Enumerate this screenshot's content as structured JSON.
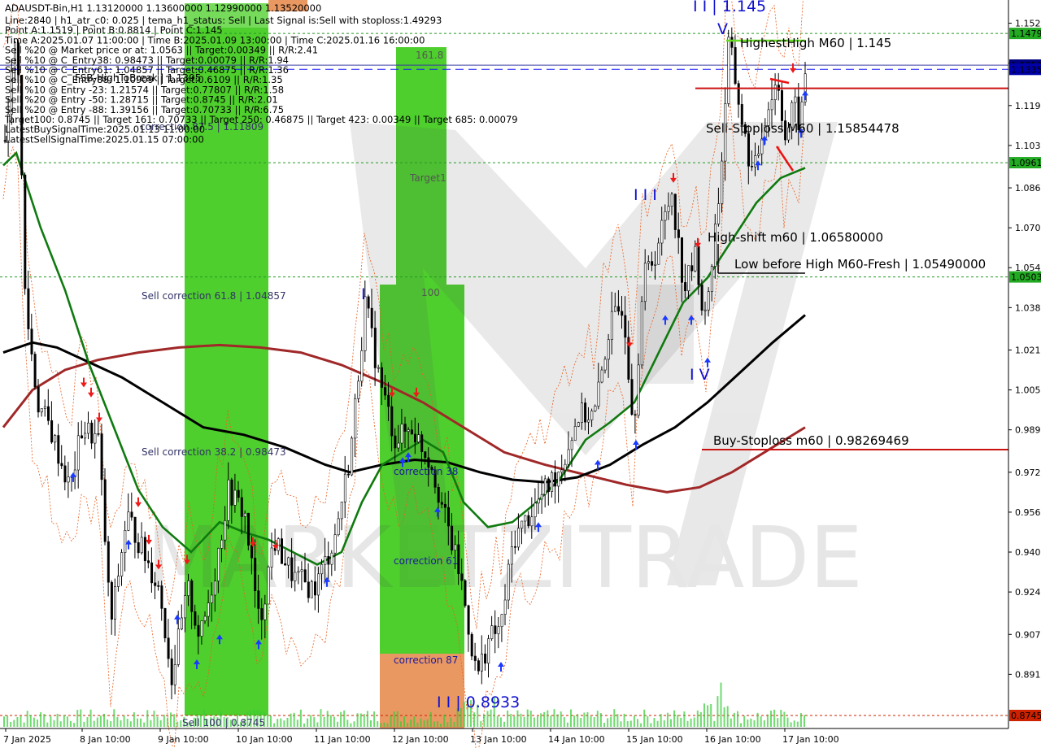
{
  "chart_data": {
    "type": "candlestick",
    "symbol_header": "ADAUSDT-Bin,H1  1.13120000 1.13600000 1.12990000 1.13520000",
    "info_lines": [
      "Line:2840 | h1_atr_c0: 0.025 | tema_h1_status: Sell | Last Signal is:Sell with stoploss:1.49293",
      "Point A:1.1519 | Point B:0.8814 | Point C:1.145",
      "Time A:2025.01.07 11:00:00 | Time B:2025.01.09 13:00:00 | Time C:2025.01.16 16:00:00",
      "Sell %20 @ Market price or at: 1.0563 || Target:0.00349 || R/R:2.41",
      "Sell %10 @ C_Entry38: 0.98473 || Target:0.00079 || R/R:1.94",
      "Sell %10 @ C_Entry61: 1.04857 || Target:0.46875 || R/R:1.36",
      "Sell %10 @ C_Entry88: 1.10909 || Target:0.6109 || R/R:1.35",
      "Sell %10 @ Entry -23: 1.21574 || Target:0.77807 || R/R:1.58",
      "Sell %20 @ Entry -50: 1.28715 || Target:0.8745 || R/R:2.01",
      "Sell %20 @ Entry -88: 1.39156 || Target:0.70733 || R/R:6.75",
      "Target100: 0.8745 || Target 161: 0.70733 || Target 250: 0.46875 || Target 423: 0.00349 || Target 685: 0.00079",
      "LatestBuySignalTime:2025.01.13 11:00:00",
      "LatestSellSignalTime:2025.01.15 07:00:00"
    ],
    "y_axis": {
      "min": 0.8745,
      "max": 1.16,
      "ticks": [
        "1.152",
        "1.136",
        "1.119",
        "1.103",
        "1.086",
        "1.070",
        "1.054",
        "1.038",
        "1.021",
        "1.005",
        "0.989",
        "0.972",
        "0.956",
        "0.940",
        "0.924",
        "0.907",
        "0.891"
      ]
    },
    "x_axis": {
      "ticks": [
        "7 Jan 2025",
        "8 Jan 10:00",
        "9 Jan 10:00",
        "10 Jan 10:00",
        "11 Jan 10:00",
        "12 Jan 10:00",
        "13 Jan 10:00",
        "14 Jan 10:00",
        "15 Jan 10:00",
        "16 Jan 10:00",
        "17 Jan 10:00"
      ]
    },
    "price_tags": [
      {
        "text": "1.1479",
        "value": 1.1479,
        "color": "#22aa22"
      },
      {
        "text": "1.1352",
        "value": 1.1352,
        "color": "#000080"
      },
      {
        "text": "1.1335",
        "value": 1.1335,
        "color": "#0000aa"
      },
      {
        "text": "1.0961",
        "value": 1.0961,
        "color": "#22aa22"
      },
      {
        "text": "1.0503",
        "value": 1.0503,
        "color": "#22aa22"
      },
      {
        "text": "0.8745",
        "value": 0.8745,
        "color": "#cc2200"
      }
    ],
    "annotations": [
      {
        "text": "HighestHigh   M60 | 1.145",
        "value": 1.145
      },
      {
        "text": "Sell-Stoploss M60 | 1.15854478",
        "value": 1.1585
      },
      {
        "text": "High-shift m60 | 1.06580000",
        "value": 1.0658
      },
      {
        "text": "Low before High   M60-Fresh | 1.05490000",
        "value": 1.0549
      },
      {
        "text": "Buy-Stoploss m60 | 0.98269469",
        "value": 0.9827
      }
    ],
    "zone_labels": [
      {
        "text": "161.8",
        "color": "#555555"
      },
      {
        "text": "Target1",
        "color": "#555555"
      },
      {
        "text": "100",
        "color": "#555555"
      },
      {
        "text": "correction 87.5 | 1.11809",
        "color": "#333366"
      },
      {
        "text": "Sell correction 61.8 | 1.04857",
        "color": "#333366"
      },
      {
        "text": "Sell correction 38.2 | 0.98473",
        "color": "#333366"
      },
      {
        "text": "correction 38",
        "color": "#1a1aa0"
      },
      {
        "text": "correction 61",
        "color": "#1a1aa0"
      },
      {
        "text": "correction 87",
        "color": "#1a1aa0"
      },
      {
        "text": "Sell 100 | 0.8745",
        "color": "#333366"
      },
      {
        "text": "FSB-HighToBreak | 1.1395",
        "color": "#000000"
      }
    ],
    "wave_labels": [
      "I",
      "I I | 0.8933",
      "I I I",
      "I V",
      "V",
      "I I | 1.145"
    ],
    "watermark": "MARKETZITRADE",
    "series": [
      {
        "name": "TEMA-fast",
        "color": "#0f7a0f"
      },
      {
        "name": "EMA-mid",
        "color": "#000000"
      },
      {
        "name": "EMA-slow",
        "color": "#992222"
      }
    ]
  }
}
